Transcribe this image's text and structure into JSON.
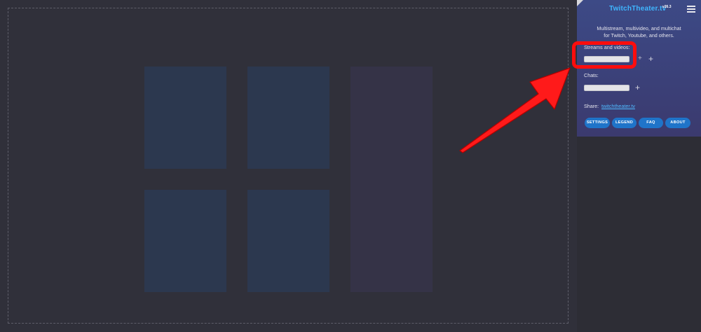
{
  "app": {
    "name": "TwitchTheater.tv",
    "version": "v26.3",
    "tagline_line1": "Multistream, multivideo, and multichat",
    "tagline_line2": "for Twitch, Youtube, and others."
  },
  "streams": {
    "label": "Streams and videos:",
    "input_value": "",
    "add_glyph": "+"
  },
  "chats": {
    "label": "Chats:",
    "input_value": "",
    "add_glyph": "+"
  },
  "share": {
    "label": "Share:",
    "link": "twitchtheater.tv"
  },
  "buttons": {
    "settings": "SETTINGS",
    "legend": "LEGEND",
    "faq": "FAQ",
    "about": "ABOUT"
  },
  "icons": {
    "menu": "hamburger-menu-icon",
    "add": "plus-icon"
  },
  "colors": {
    "panel_top": "#3d4a86",
    "brand": "#3fb6ff",
    "button": "#1f74c9",
    "annotation": "#ff0d0d",
    "stream_tile": "#2c384f",
    "chat_tile": "#353347"
  }
}
